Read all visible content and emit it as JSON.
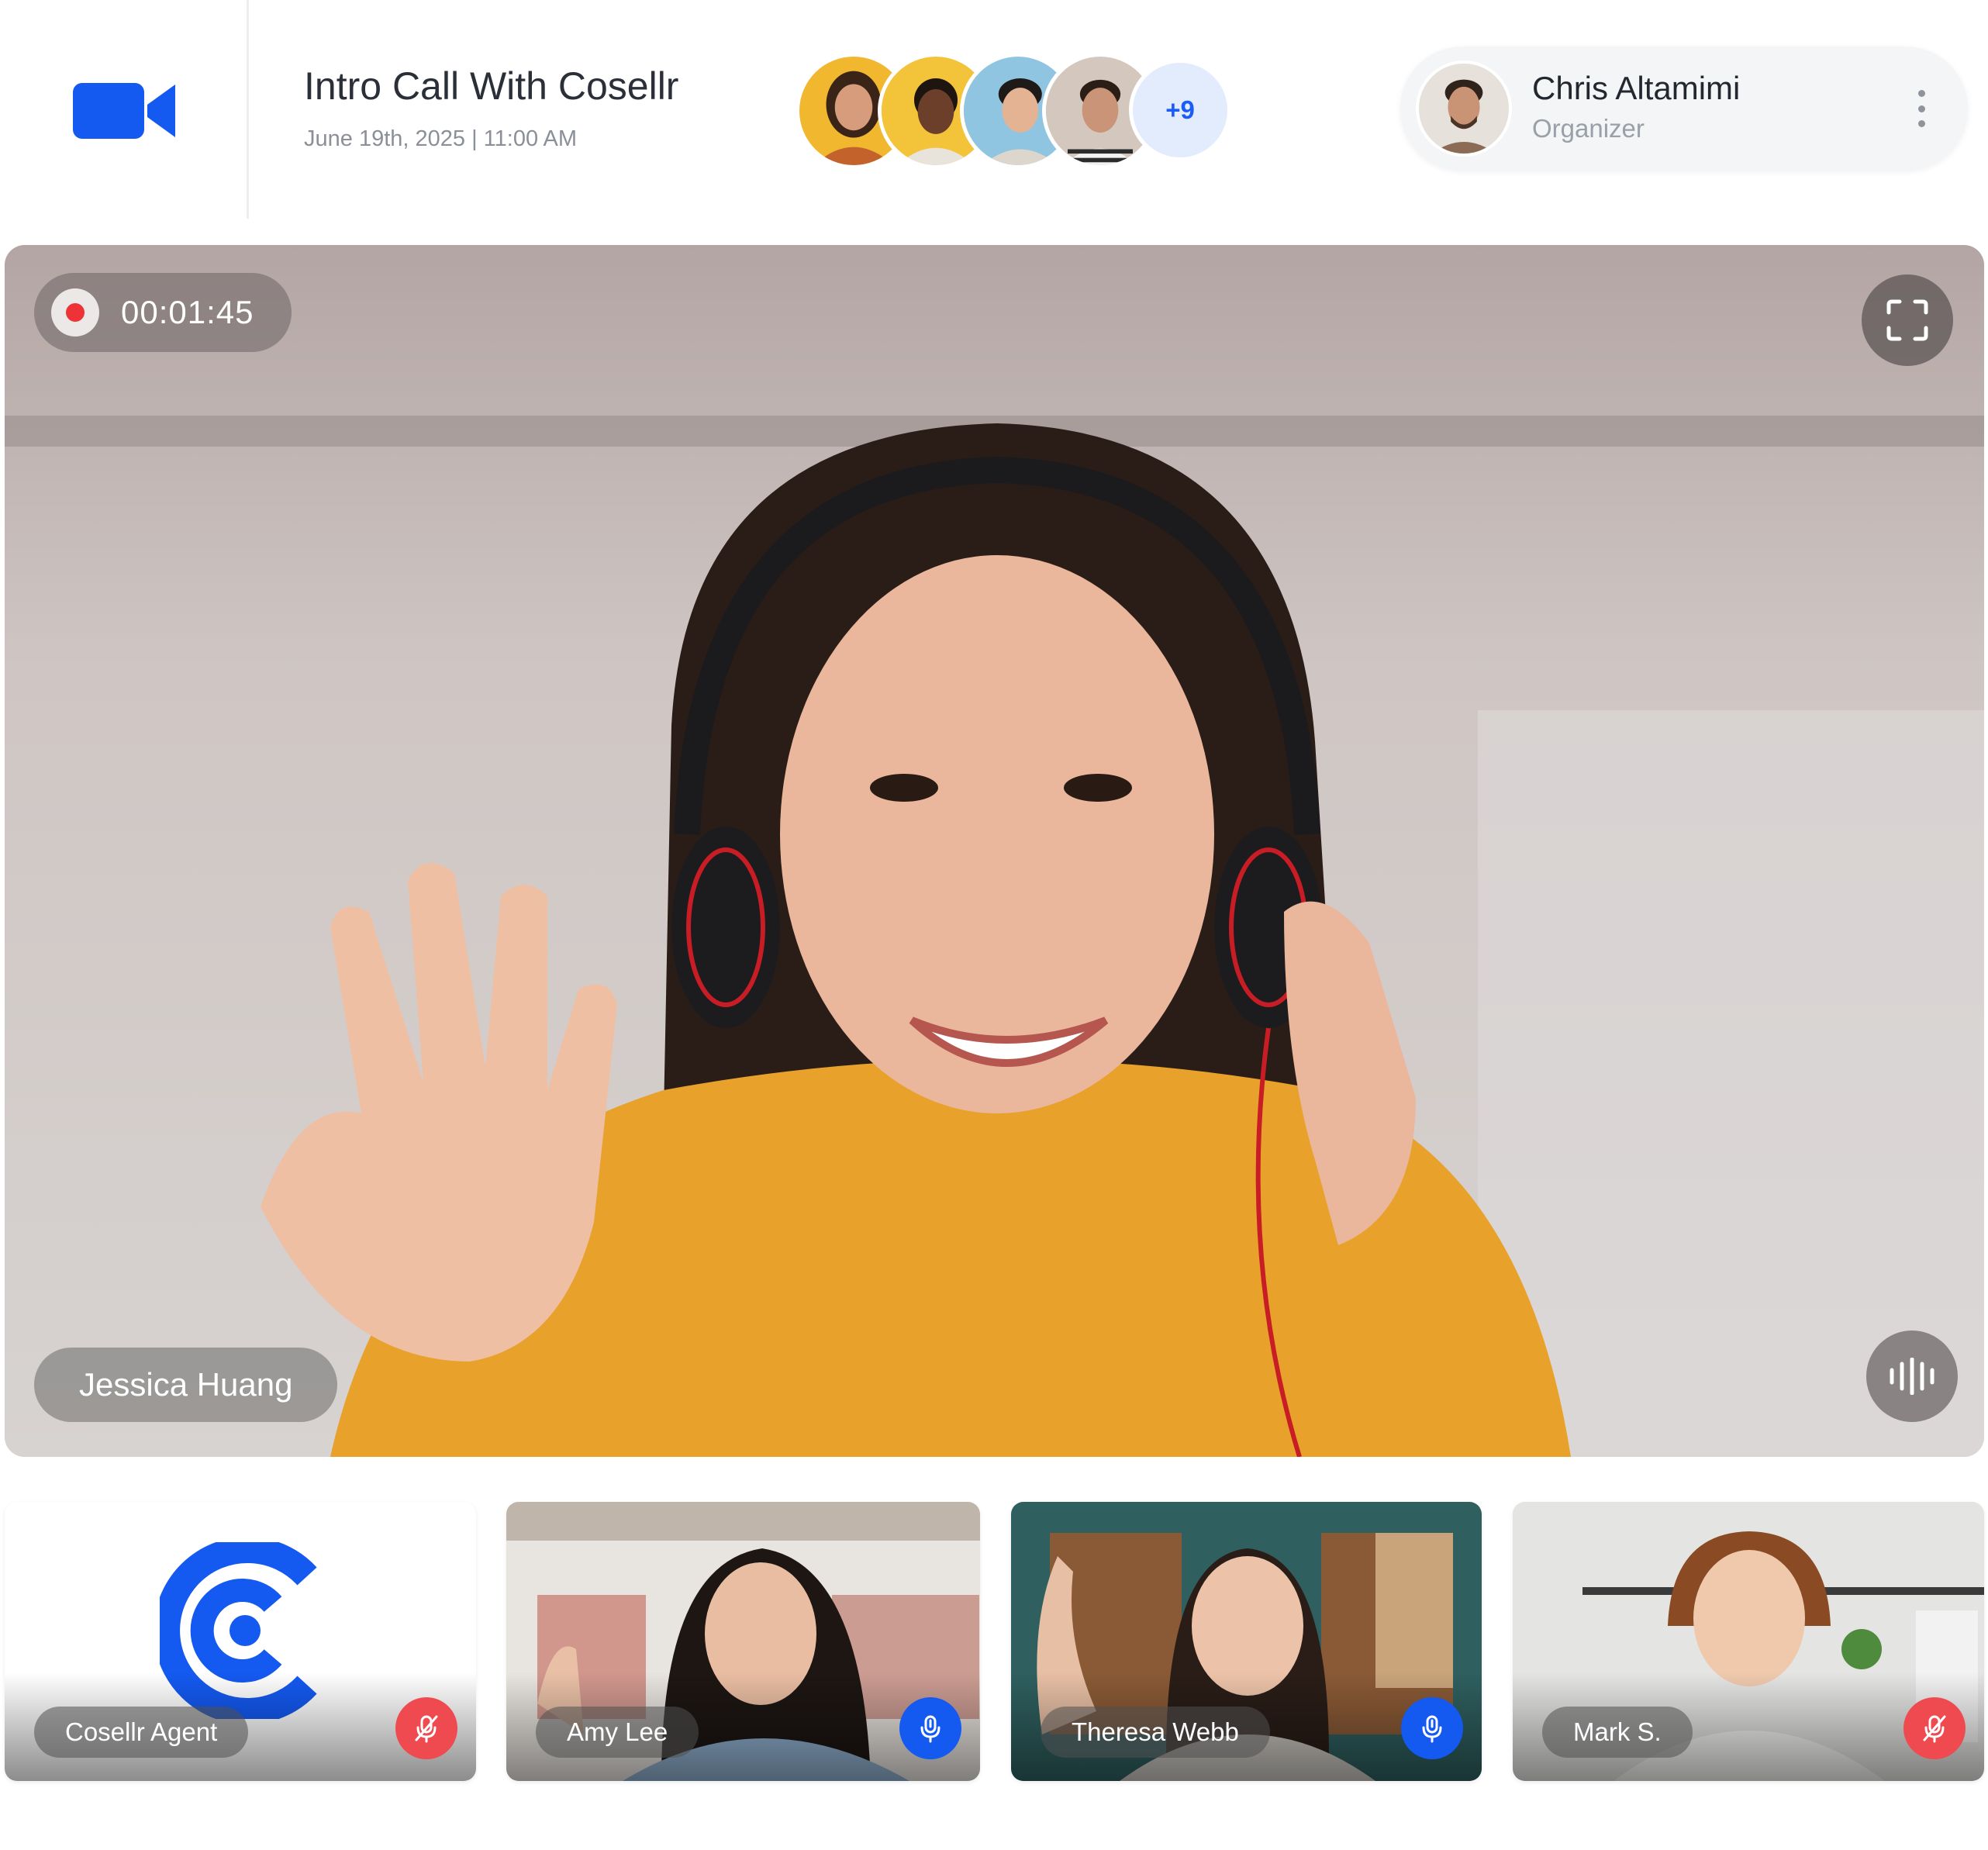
{
  "meeting": {
    "title": "Intro Call With Cosellr",
    "datetime": "June 19th, 2025 | 11:00 AM",
    "app_icon": "video-camera-icon",
    "brand_color": "#1459f0"
  },
  "participants": {
    "avatars": [
      "participant-avatar-1",
      "participant-avatar-2",
      "participant-avatar-3",
      "participant-avatar-4"
    ],
    "more_count": "+9"
  },
  "organizer": {
    "name": "Chris Altamimi",
    "role": "Organizer",
    "menu_icon": "more-vertical-icon"
  },
  "stage": {
    "recording_time": "00:01:45",
    "recording_icon": "record-dot-icon",
    "speaker_name": "Jessica Huang",
    "fullscreen_icon": "fullscreen-icon",
    "audio_icon": "audio-wave-icon"
  },
  "tiles": [
    {
      "name": "Cosellr Agent",
      "mic": "muted",
      "mic_icon": "mic-off-icon"
    },
    {
      "name": "Amy Lee",
      "mic": "live",
      "mic_icon": "mic-icon"
    },
    {
      "name": "Theresa Webb",
      "mic": "live",
      "mic_icon": "mic-icon"
    },
    {
      "name": "Mark S.",
      "mic": "muted",
      "mic_icon": "mic-off-icon"
    }
  ],
  "colors": {
    "accent": "#1459f0",
    "muted_red": "#ee4a50",
    "record_red": "#ee3338",
    "more_badge_bg": "#e3ecfd"
  }
}
